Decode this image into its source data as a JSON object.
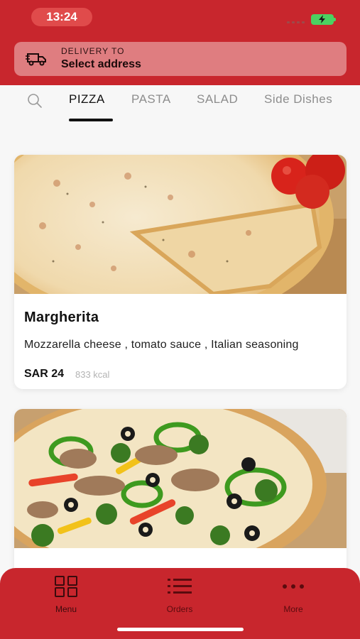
{
  "status_bar": {
    "time": "13:24"
  },
  "delivery": {
    "label": "DELIVERY TO",
    "address": "Select address"
  },
  "categories": [
    "PIZZA",
    "PASTA",
    "SALAD",
    "Side Dishes"
  ],
  "products": [
    {
      "name": "Margherita",
      "description": "Mozzarella cheese , tomato sauce , Italian seasoning",
      "price": "SAR 24",
      "calories": "833 kcal"
    },
    {
      "name": "",
      "description": "",
      "price": "",
      "calories": ""
    }
  ],
  "bottom_nav": [
    {
      "label": "Menu",
      "icon": "grid-icon"
    },
    {
      "label": "Orders",
      "icon": "list-icon"
    },
    {
      "label": "More",
      "icon": "more-icon"
    }
  ],
  "colors": {
    "brand_red": "#c8262d",
    "address_pill": "#df7d80"
  }
}
